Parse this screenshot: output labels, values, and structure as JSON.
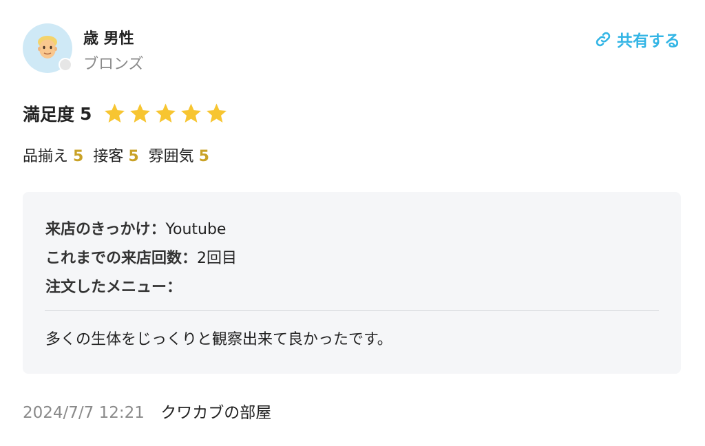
{
  "user": {
    "name": "歳 男性",
    "rank": "ブロンズ",
    "avatar_icon": "man-face-icon"
  },
  "share": {
    "label": "共有する",
    "icon": "link-icon",
    "color": "#33b5e5"
  },
  "satisfaction": {
    "label": "満足度",
    "value": "5",
    "stars": 5,
    "max_stars": 5,
    "star_color": "#f7c531"
  },
  "sub_ratings": [
    {
      "label": "品揃え",
      "value": "5"
    },
    {
      "label": "接客",
      "value": "5"
    },
    {
      "label": "雰囲気",
      "value": "5"
    }
  ],
  "details": {
    "trigger_label": "来店のきっかけ：",
    "trigger_value": "Youtube",
    "visits_label": "これまでの来店回数：",
    "visits_value": "2回目",
    "menu_label": "注文したメニュー：",
    "menu_value": ""
  },
  "comment": "多くの生体をじっくりと観察出来て良かったです。",
  "footer": {
    "date": "2024/7/7 12:21",
    "shop_name": "クワカブの部屋"
  }
}
